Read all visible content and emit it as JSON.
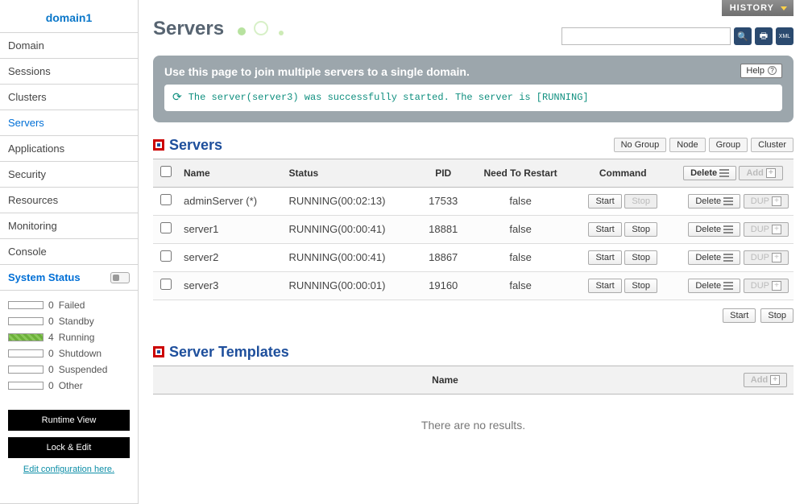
{
  "sidebar": {
    "title": "domain1",
    "items": [
      {
        "label": "Domain"
      },
      {
        "label": "Sessions"
      },
      {
        "label": "Clusters"
      },
      {
        "label": "Servers",
        "active": true
      },
      {
        "label": "Applications"
      },
      {
        "label": "Security"
      },
      {
        "label": "Resources"
      },
      {
        "label": "Monitoring"
      },
      {
        "label": "Console"
      }
    ],
    "system_status_label": "System Status",
    "stats": [
      {
        "count": "0",
        "label": "Failed",
        "fill": false
      },
      {
        "count": "0",
        "label": "Standby",
        "fill": false
      },
      {
        "count": "4",
        "label": "Running",
        "fill": true
      },
      {
        "count": "0",
        "label": "Shutdown",
        "fill": false
      },
      {
        "count": "0",
        "label": "Suspended",
        "fill": false
      },
      {
        "count": "0",
        "label": "Other",
        "fill": false
      }
    ],
    "runtime_btn": "Runtime View",
    "lock_btn": "Lock & Edit",
    "edit_link": "Edit configuration here."
  },
  "header": {
    "history": "HISTORY",
    "page_title": "Servers",
    "search_placeholder": ""
  },
  "info": {
    "text": "Use this page to join multiple servers to a single domain.",
    "help": "Help",
    "message": "The server(server3) was successfully started. The server is [RUNNING]"
  },
  "servers_section": {
    "title": "Servers",
    "views": [
      "No Group",
      "Node",
      "Group",
      "Cluster"
    ],
    "head": {
      "name": "Name",
      "status": "Status",
      "pid": "PID",
      "restart": "Need To Restart",
      "command": "Command",
      "delete": "Delete",
      "add": "Add"
    },
    "btn": {
      "start": "Start",
      "stop": "Stop",
      "delete": "Delete",
      "dup": "DUP"
    },
    "rows": [
      {
        "name": "adminServer (*)",
        "status": "RUNNING(00:02:13)",
        "pid": "17533",
        "restart": "false",
        "stop_disabled": true,
        "dup_disabled": true
      },
      {
        "name": "server1",
        "status": "RUNNING(00:00:41)",
        "pid": "18881",
        "restart": "false",
        "stop_disabled": false,
        "dup_disabled": true
      },
      {
        "name": "server2",
        "status": "RUNNING(00:00:41)",
        "pid": "18867",
        "restart": "false",
        "stop_disabled": false,
        "dup_disabled": true
      },
      {
        "name": "server3",
        "status": "RUNNING(00:00:01)",
        "pid": "19160",
        "restart": "false",
        "stop_disabled": false,
        "dup_disabled": true
      }
    ],
    "footer": {
      "start": "Start",
      "stop": "Stop"
    }
  },
  "templates_section": {
    "title": "Server Templates",
    "head": {
      "name": "Name",
      "add": "Add"
    },
    "empty": "There are no results."
  }
}
